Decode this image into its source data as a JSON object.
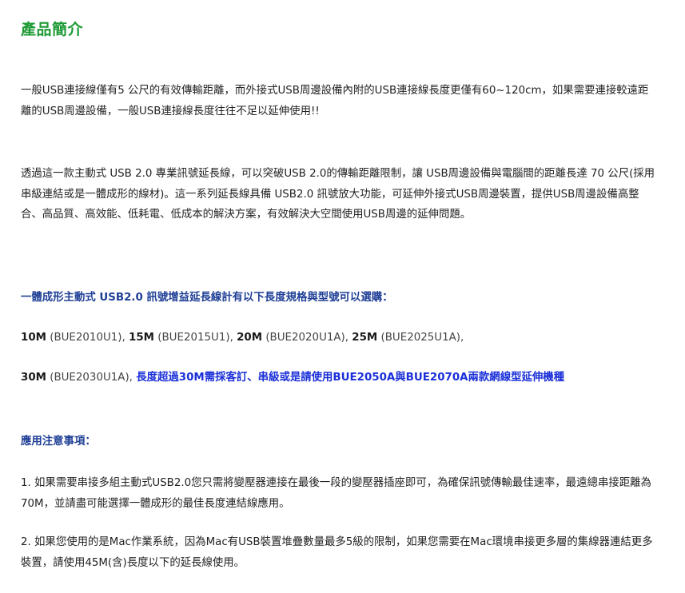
{
  "title": "產品簡介",
  "intro_paragraph": "一般USB連接線僅有5 公尺的有效傳輸距離，而外接式USB周邊設備內附的USB連接線長度更僅有60~120cm，如果需要連接較遠距離的USB周邊設備，一般USB連接線長度往往不足以延伸使用!!",
  "description_paragraph": "透過這一款主動式 USB 2.0 專業訊號延長線，可以突破USB 2.0的傳輸距離限制，讓 USB周邊設備與電腦間的距離長達 70 公尺(採用串級連結或是一體成形的線材)。這一系列延長線具備 USB2.0 訊號放大功能，可延伸外接式USB周邊裝置，提供USB周邊設備高整合、高品質、高效能、低耗電、低成本的解決方案，有效解決大空間使用USB周邊的延伸問題。",
  "models_heading": "一體成形主動式 USB2.0 訊號增益延長線計有以下長度規格與型號可以選購：",
  "models_line1": [
    {
      "size": "10M",
      "code": " (BUE2010U1), "
    },
    {
      "size": "15M",
      "code": " (BUE2015U1), "
    },
    {
      "size": "20M",
      "code": " (BUE2020U1A), "
    },
    {
      "size": "25M",
      "code": " (BUE2025U1A),"
    }
  ],
  "models_line2": {
    "size": "30M",
    "code": " (BUE2030U1A), ",
    "note": "長度超過30M需採客訂、串級或是請使用BUE2050A與BUE2070A兩款網線型延伸機種"
  },
  "notes_heading": "應用注意事項：",
  "notes": [
    "1. 如果需要串接多組主動式USB2.0您只需將變壓器連接在最後一段的變壓器插座即可，為確保訊號傳輸最佳速率，最遠總串接距離為70M，並請盡可能選擇一體成形的最佳長度連結線應用。",
    "2. 如果您使用的是Mac作業系統，因為Mac有USB裝置堆疊數量最多5級的限制，如果您需要在Mac環境串接更多層的集線器連結更多裝置，請使用45M(含)長度以下的延長線使用。"
  ],
  "colors": {
    "title": "#1e9a35",
    "heading": "#1f3f96",
    "highlight": "#1a2fd8",
    "body_text": "#222222"
  }
}
